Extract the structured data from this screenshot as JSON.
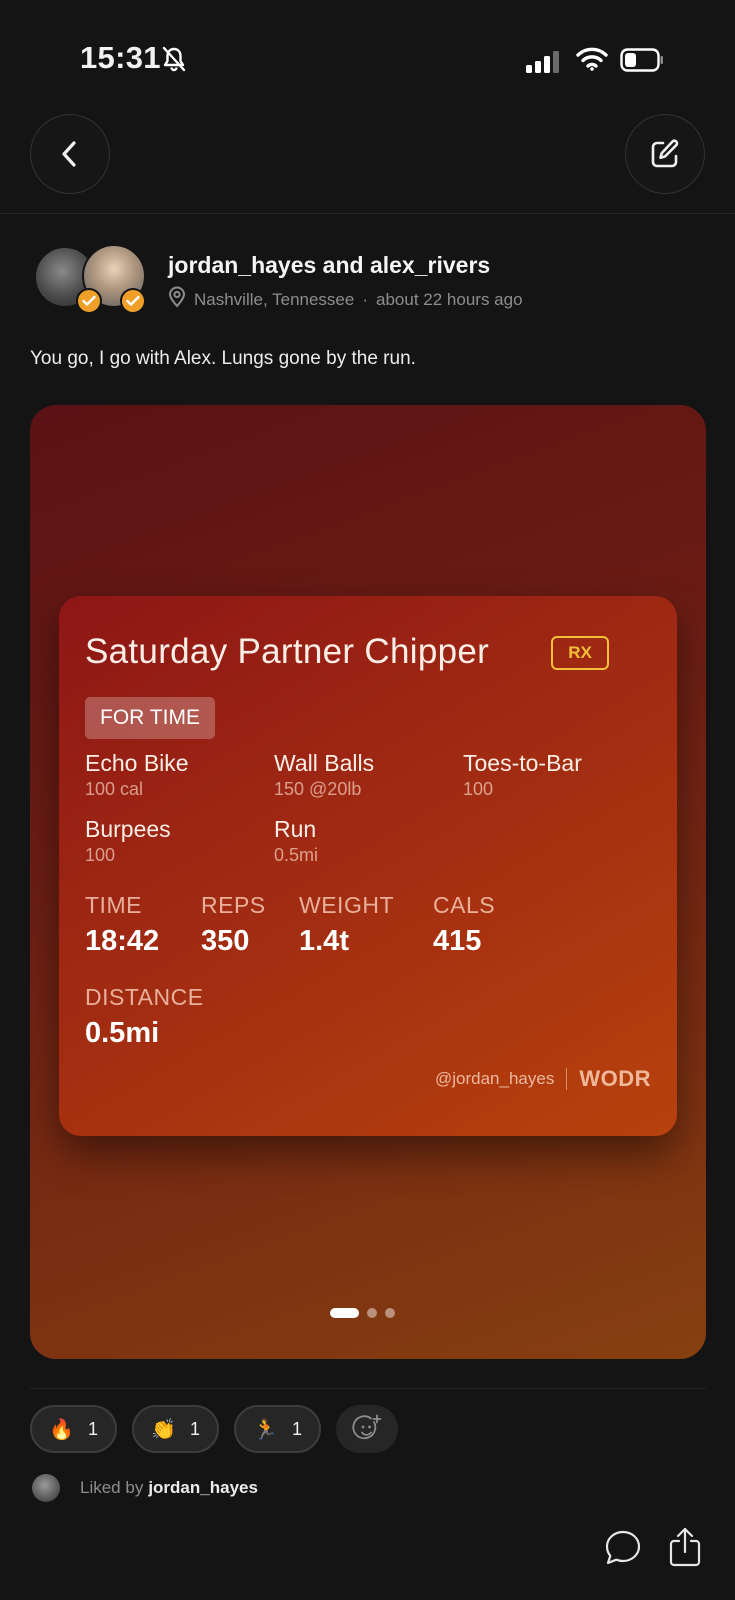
{
  "status_bar": {
    "time": "15:31",
    "icons": [
      "bell-slash-icon",
      "cellular-signal-icon",
      "wifi-icon",
      "battery-icon"
    ]
  },
  "nav": {
    "back_icon": "chevron-left-icon",
    "edit_icon": "edit-square-icon"
  },
  "post": {
    "users": "jordan_hayes and alex_rivers",
    "location": "Nashville, Tennessee",
    "separator": "·",
    "time_ago": "about 22 hours ago",
    "caption": "You go, I go with Alex. Lungs gone by the run."
  },
  "wod": {
    "title": "Saturday Partner Chipper",
    "badge": "RX",
    "type": "FOR TIME",
    "movements": [
      {
        "name": "Echo Bike",
        "detail": "100 cal"
      },
      {
        "name": "Wall Balls",
        "detail": "150  @20lb"
      },
      {
        "name": "Toes-to-Bar",
        "detail": "100"
      },
      {
        "name": "Burpees",
        "detail": "100"
      },
      {
        "name": "Run",
        "detail": "0.5mi"
      }
    ],
    "stats": [
      {
        "label": "TIME",
        "value": "18:42"
      },
      {
        "label": "REPS",
        "value": "350"
      },
      {
        "label": "WEIGHT",
        "value": "1.4t"
      },
      {
        "label": "CALS",
        "value": "415"
      },
      {
        "label": "DISTANCE",
        "value": "0.5mi"
      }
    ],
    "handle": "@jordan_hayes",
    "brand": "WODR"
  },
  "carousel": {
    "count": 3,
    "active_index": 0
  },
  "reactions": [
    {
      "emoji": "🔥",
      "count": "1",
      "icon": "fire-emoji"
    },
    {
      "emoji": "👏",
      "count": "1",
      "icon": "clapping-hands-emoji"
    },
    {
      "emoji": "🏃",
      "count": "1",
      "icon": "runner-emoji"
    }
  ],
  "liked": {
    "prefix": "Liked by",
    "user": "jordan_hayes"
  },
  "colors": {
    "background": "#141414",
    "accent_rx": "#f2c036",
    "verified_badge": "#f0a028"
  }
}
